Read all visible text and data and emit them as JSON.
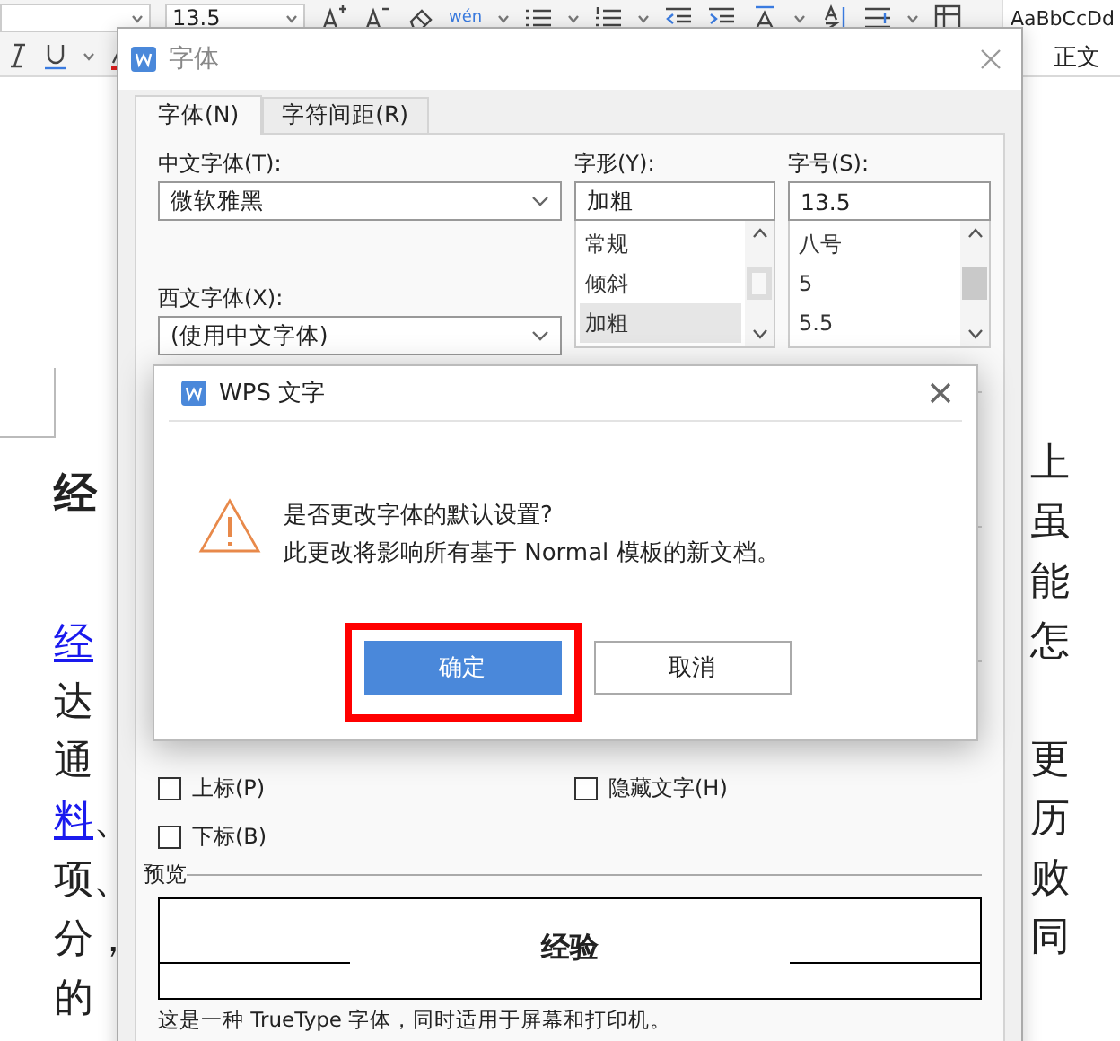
{
  "toolbar": {
    "font_size": "13.5",
    "phonetic_guide": "wén",
    "style_preview": "AaBbCcDd",
    "style_name": "正文"
  },
  "document": {
    "heading": "经",
    "lines": [
      {
        "segments": [
          {
            "text": "经",
            "kind": "link"
          }
        ]
      },
      {
        "segments": [
          {
            "text": "达",
            "kind": "text"
          }
        ]
      },
      {
        "segments": [
          {
            "text": "通",
            "kind": "text"
          }
        ]
      },
      {
        "segments": [
          {
            "text": "料",
            "kind": "link"
          },
          {
            "text": "、",
            "kind": "text"
          }
        ]
      },
      {
        "segments": [
          {
            "text": "项、",
            "kind": "text"
          }
        ]
      },
      {
        "segments": [
          {
            "text": "分，",
            "kind": "text"
          }
        ]
      },
      {
        "segments": [
          {
            "text": "的",
            "kind": "text"
          }
        ]
      }
    ],
    "right_paragraphs": [
      {
        "lines": [
          "上",
          "虽",
          "能",
          "怎"
        ]
      },
      {
        "lines": [
          "更",
          "历",
          "败",
          "同"
        ]
      }
    ]
  },
  "font_dialog": {
    "title": "字体",
    "tabs": [
      {
        "label": "字体(N)",
        "selected": true
      },
      {
        "label": "字符间距(R)",
        "selected": false
      }
    ],
    "chinese_font": {
      "label": "中文字体(T):",
      "value": "微软雅黑"
    },
    "western_font": {
      "label": "西文字体(X):",
      "value": "(使用中文字体)"
    },
    "style": {
      "label": "字形(Y):",
      "value": "加粗",
      "options": [
        {
          "label": "常规",
          "selected": false
        },
        {
          "label": "倾斜",
          "selected": false
        },
        {
          "label": "加粗",
          "selected": true
        }
      ]
    },
    "size": {
      "label": "字号(S):",
      "value": "13.5",
      "options": [
        {
          "label": "八号",
          "selected": false
        },
        {
          "label": "5",
          "selected": false
        },
        {
          "label": "5.5",
          "selected": false
        }
      ]
    },
    "effects": [
      {
        "label": "上标(P)",
        "checked": false
      },
      {
        "label": "隐藏文字(H)",
        "checked": false
      },
      {
        "label": "下标(B)",
        "checked": false
      }
    ],
    "preview": {
      "label": "预览",
      "sample": "经验"
    },
    "note": "这是一种 TrueType 字体，同时适用于屏幕和打印机。"
  },
  "message_box": {
    "title": "WPS 文字",
    "lines": [
      "是否更改字体的默认设置?",
      "此更改将影响所有基于 Normal 模板的新文档。"
    ],
    "buttons": [
      {
        "label": "确定",
        "kind": "primary",
        "highlighted": true
      },
      {
        "label": "取消",
        "kind": "secondary",
        "highlighted": false
      }
    ]
  }
}
